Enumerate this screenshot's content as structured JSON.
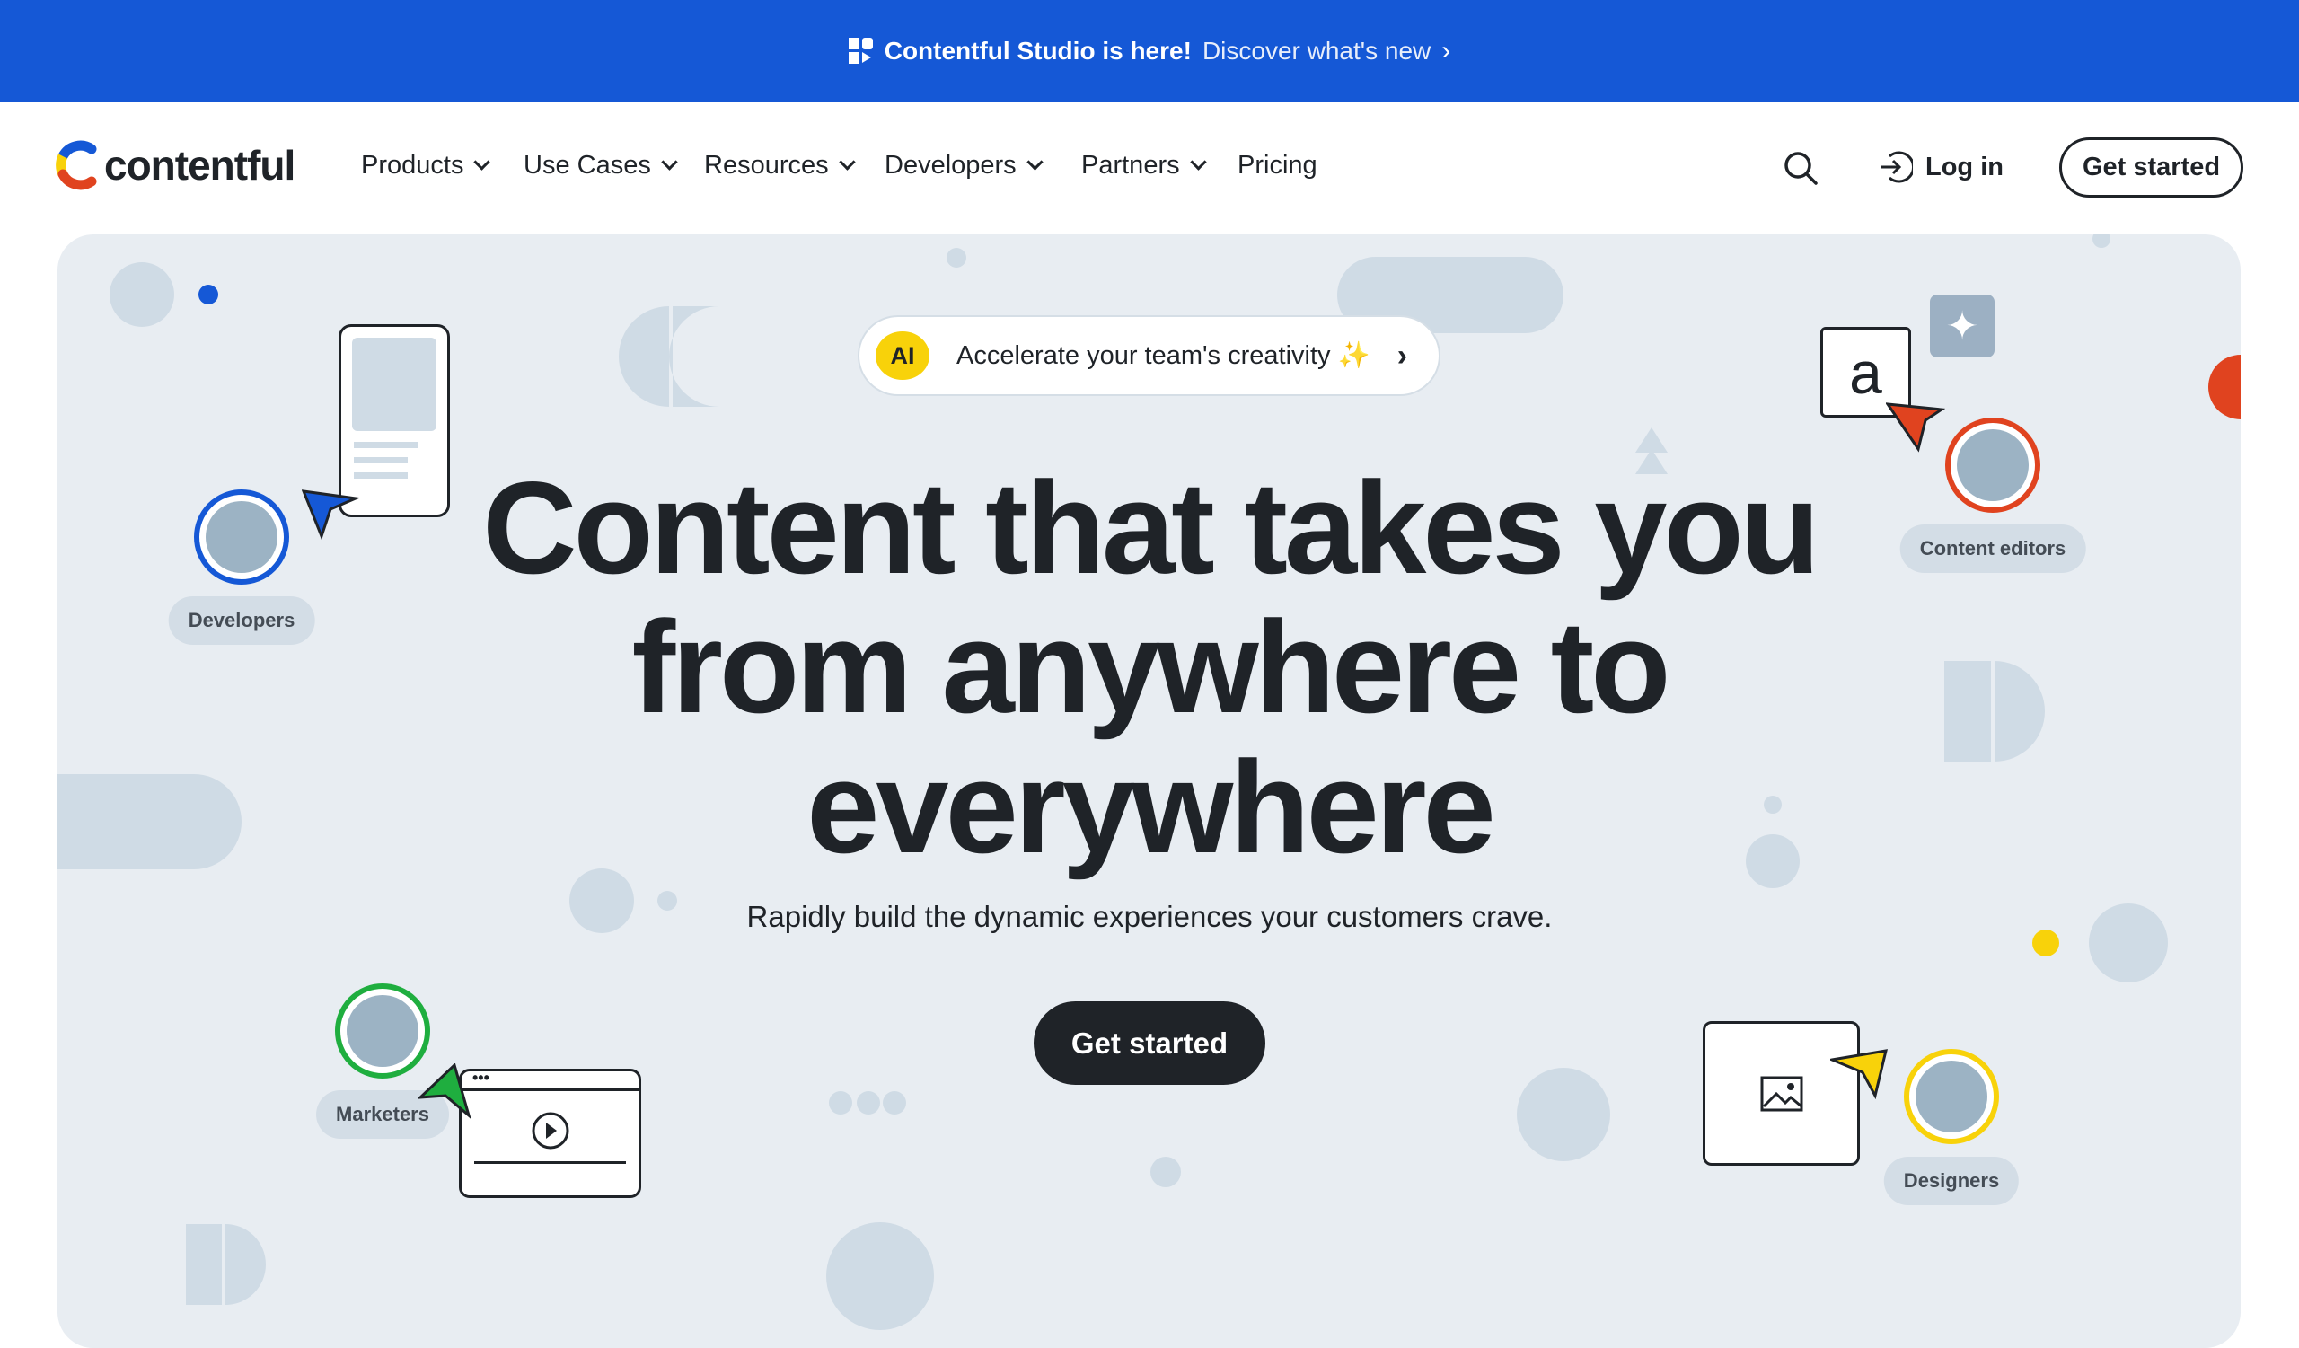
{
  "banner": {
    "icon": "studio-icon",
    "headline": "Contentful Studio is here!",
    "link": "Discover what's new",
    "bg": "#1558d6"
  },
  "nav": {
    "logo": "contentful",
    "items": [
      {
        "label": "Products"
      },
      {
        "label": "Use Cases"
      },
      {
        "label": "Resources"
      },
      {
        "label": "Developers"
      },
      {
        "label": "Partners"
      },
      {
        "label": "Pricing"
      }
    ],
    "login": "Log in",
    "get_started": "Get started"
  },
  "hero": {
    "pill": {
      "badge": "AI",
      "text": "Accelerate your team's creativity ✨"
    },
    "headline": [
      "Content that takes you",
      "from anywhere to",
      "everywhere"
    ],
    "subtitle": "Rapidly build the dynamic experiences your customers crave.",
    "cta": "Get started",
    "personas": [
      {
        "label": "Developers",
        "color": "#1558d6"
      },
      {
        "label": "Content editors",
        "color": "#e0431f"
      },
      {
        "label": "Marketers",
        "color": "#1fae3f"
      },
      {
        "label": "Designers",
        "color": "#f8d20a"
      }
    ],
    "letter_box": "a"
  }
}
